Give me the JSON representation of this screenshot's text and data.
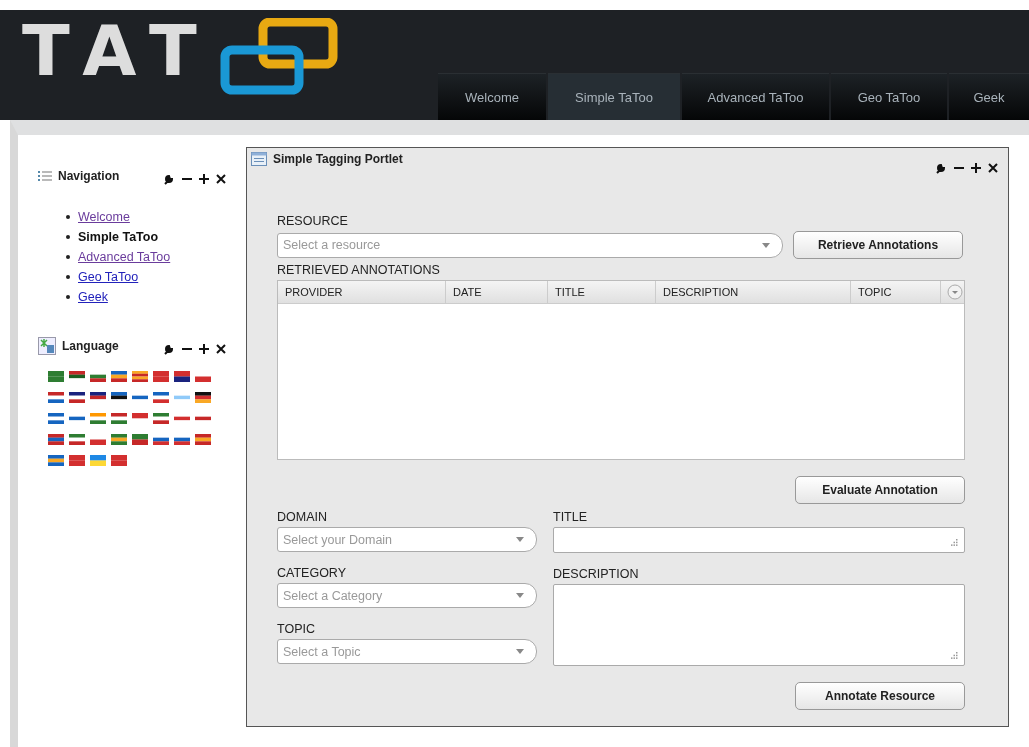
{
  "logo": {
    "text": "TAT"
  },
  "tabs": [
    {
      "label": "Welcome",
      "selected": false
    },
    {
      "label": "Simple TaToo",
      "selected": true
    },
    {
      "label": "Advanced TaToo",
      "selected": false
    },
    {
      "label": "Geo TaToo",
      "selected": false
    },
    {
      "label": "Geek",
      "selected": false
    }
  ],
  "navigation": {
    "title": "Navigation",
    "items": [
      {
        "label": "Welcome",
        "selected": false,
        "visited": true
      },
      {
        "label": "Simple TaToo",
        "selected": true,
        "visited": false
      },
      {
        "label": "Advanced TaToo",
        "selected": false,
        "visited": true
      },
      {
        "label": "Geo TaToo",
        "selected": false,
        "visited": false
      },
      {
        "label": "Geek",
        "selected": false,
        "visited": false
      }
    ]
  },
  "language": {
    "title": "Language"
  },
  "portlet": {
    "title": "Simple Tagging Portlet",
    "resource": {
      "label": "RESOURCE",
      "placeholder": "Select a resource"
    },
    "retrieve_button": "Retrieve Annotations",
    "annotations": {
      "label": "RETRIEVED ANNOTATIONS",
      "columns": [
        "PROVIDER",
        "DATE",
        "TITLE",
        "DESCRIPTION",
        "TOPIC"
      ]
    },
    "evaluate_button": "Evaluate Annotation",
    "domain": {
      "label": "DOMAIN",
      "placeholder": "Select your Domain"
    },
    "category": {
      "label": "CATEGORY",
      "placeholder": "Select a Category"
    },
    "topic": {
      "label": "TOPIC",
      "placeholder": "Select a Topic"
    },
    "title_field": {
      "label": "TITLE"
    },
    "description_field": {
      "label": "DESCRIPTION"
    },
    "annotate_button": "Annotate Resource"
  }
}
